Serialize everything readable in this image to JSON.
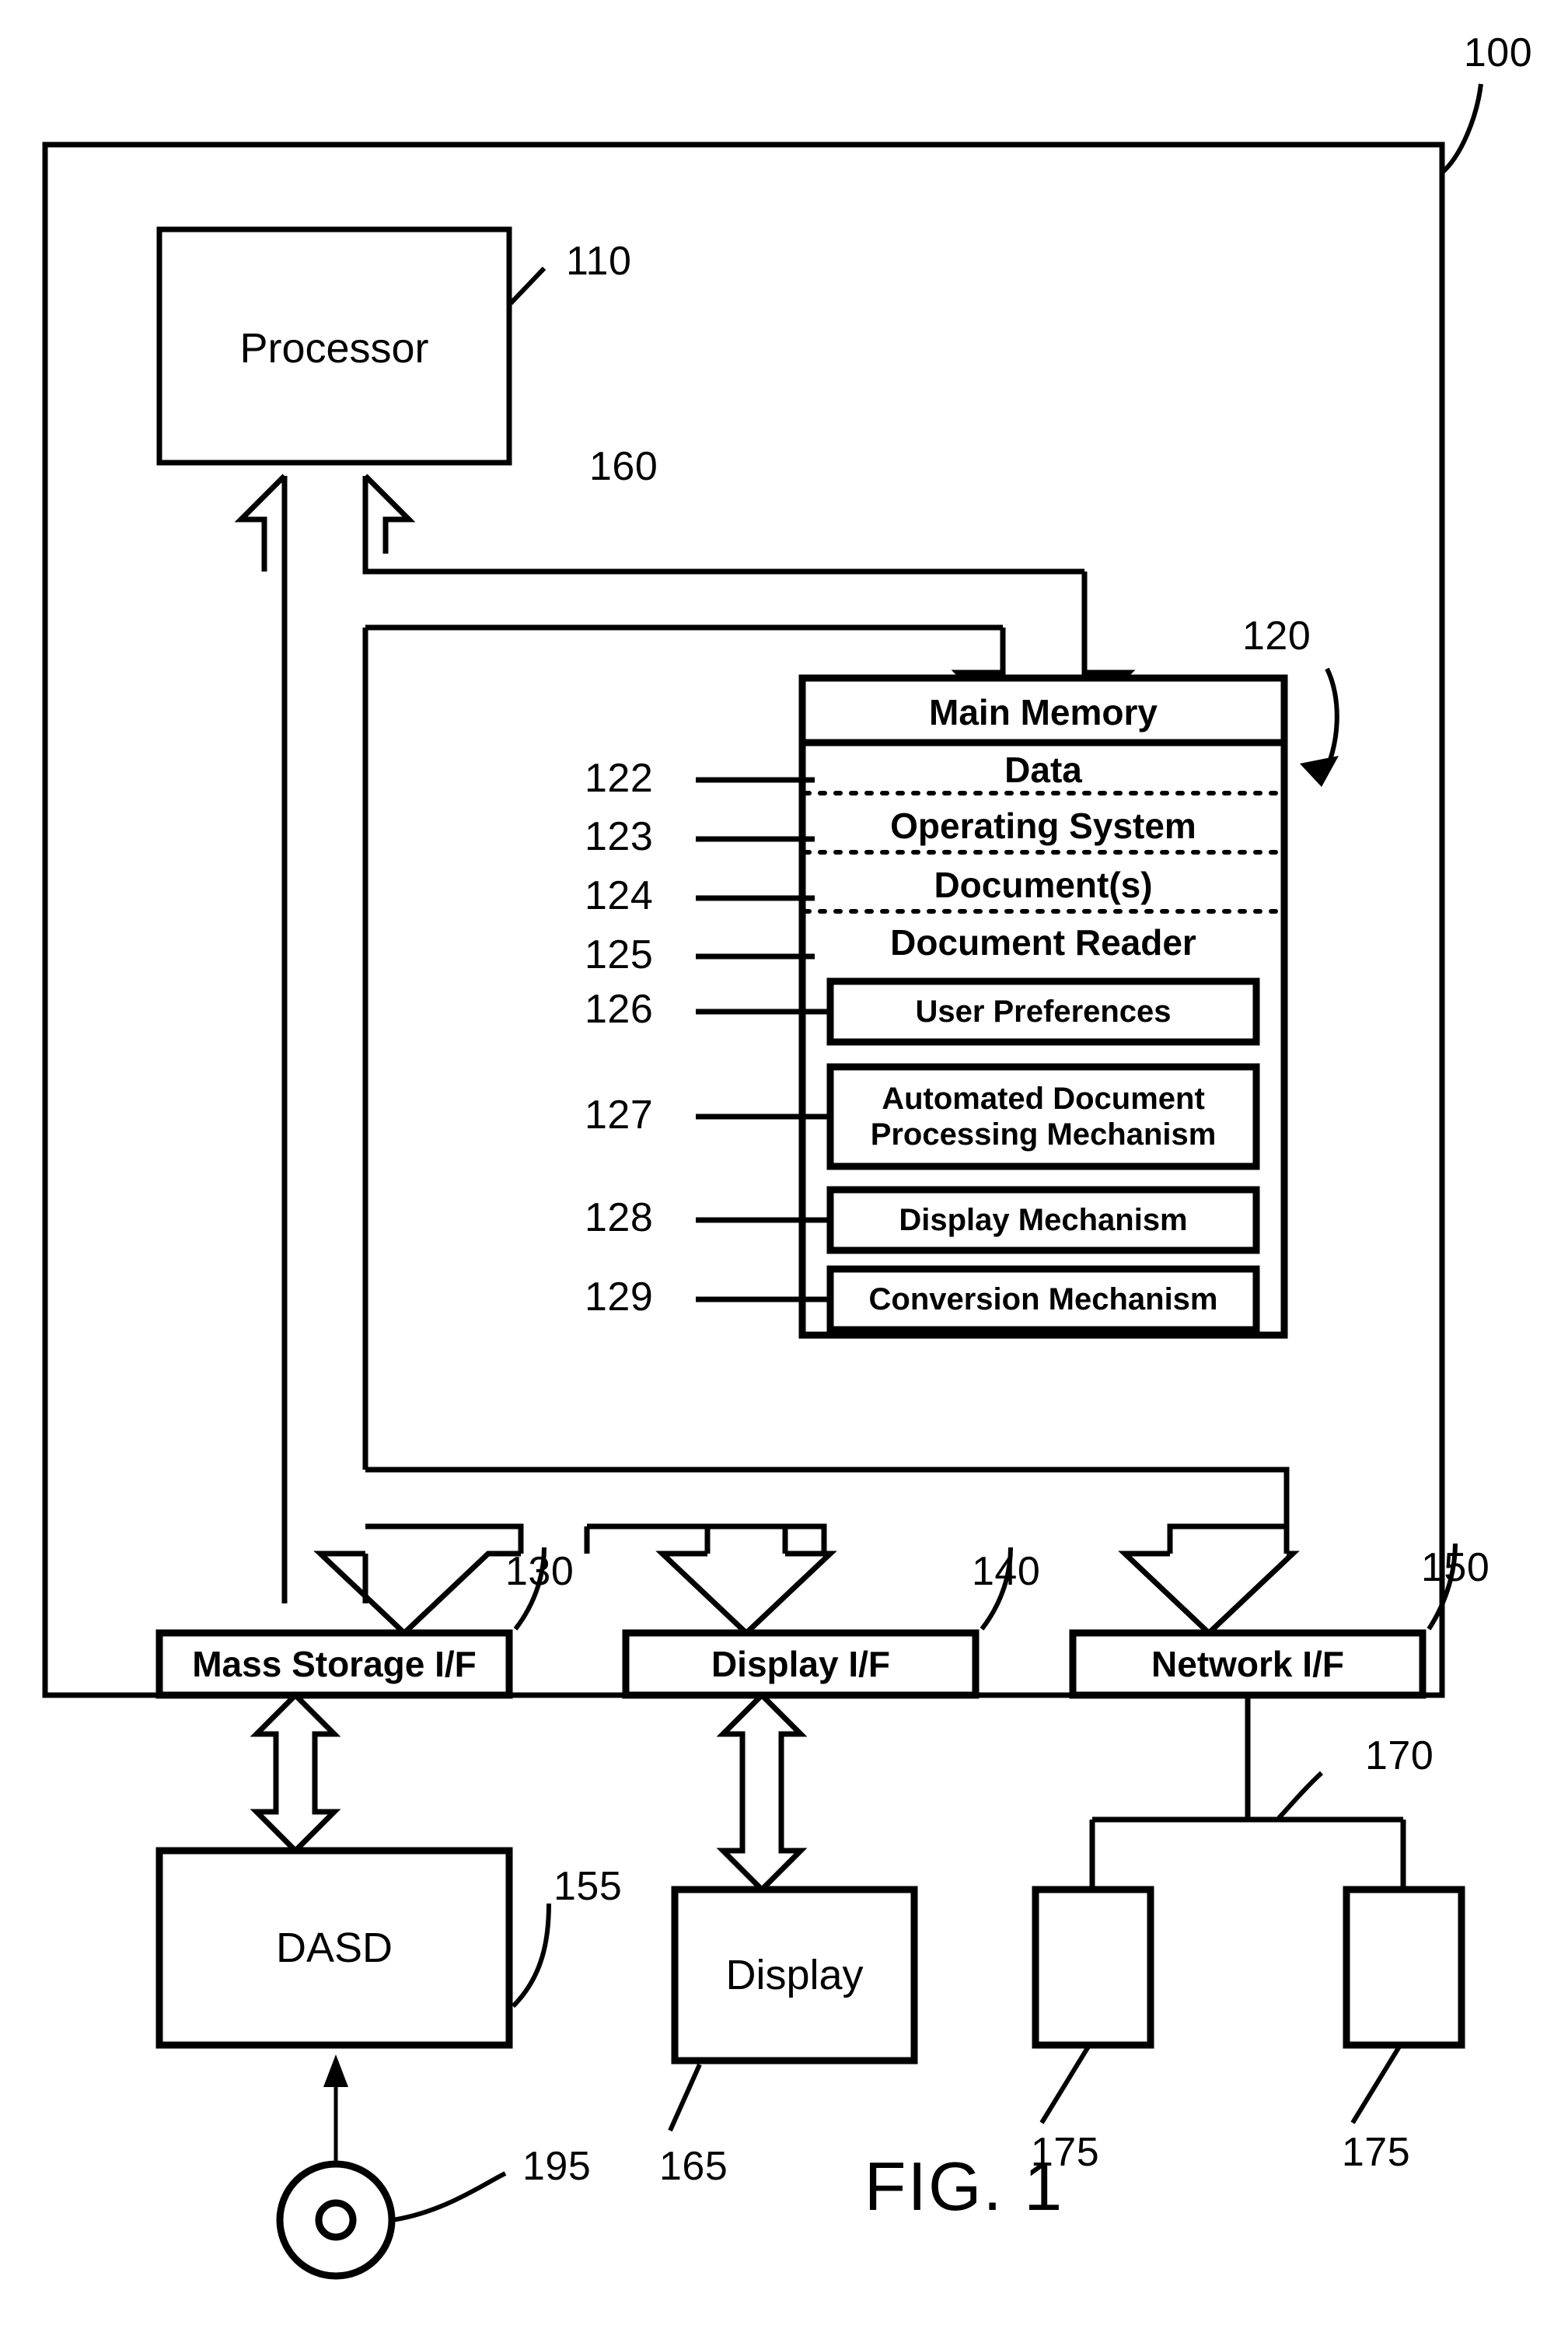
{
  "figure": {
    "caption": "FIG. 1",
    "system_ref": "100"
  },
  "processor": {
    "label": "Processor",
    "ref": "110"
  },
  "bus": {
    "ref": "160"
  },
  "main_memory": {
    "title": "Main Memory",
    "ref": "120",
    "segments": [
      {
        "label": "Data",
        "ref": "122"
      },
      {
        "label": "Operating System",
        "ref": "123"
      },
      {
        "label": "Document(s)",
        "ref": "124"
      },
      {
        "label": "Document Reader",
        "ref": "125"
      }
    ],
    "modules": [
      {
        "label": "User Preferences",
        "ref": "126"
      },
      {
        "label": "Automated Document Processing Mechanism",
        "ref": "127"
      },
      {
        "label": "Display Mechanism",
        "ref": "128"
      },
      {
        "label": "Conversion Mechanism",
        "ref": "129"
      }
    ]
  },
  "interfaces": [
    {
      "label": "Mass Storage I/F",
      "ref": "130"
    },
    {
      "label": "Display I/F",
      "ref": "140"
    },
    {
      "label": "Network I/F",
      "ref": "150"
    }
  ],
  "peripherals": [
    {
      "label": "DASD",
      "ref": "155"
    },
    {
      "label": "Display",
      "ref": "165"
    }
  ],
  "network": {
    "ref": "170",
    "nodes": [
      {
        "label": "",
        "ref": "175"
      },
      {
        "label": "",
        "ref": "175"
      }
    ]
  },
  "removable_media": {
    "ref": "195",
    "icon": "optical-disc-icon"
  },
  "style": {
    "line_color": "#000000",
    "background": "#ffffff"
  }
}
